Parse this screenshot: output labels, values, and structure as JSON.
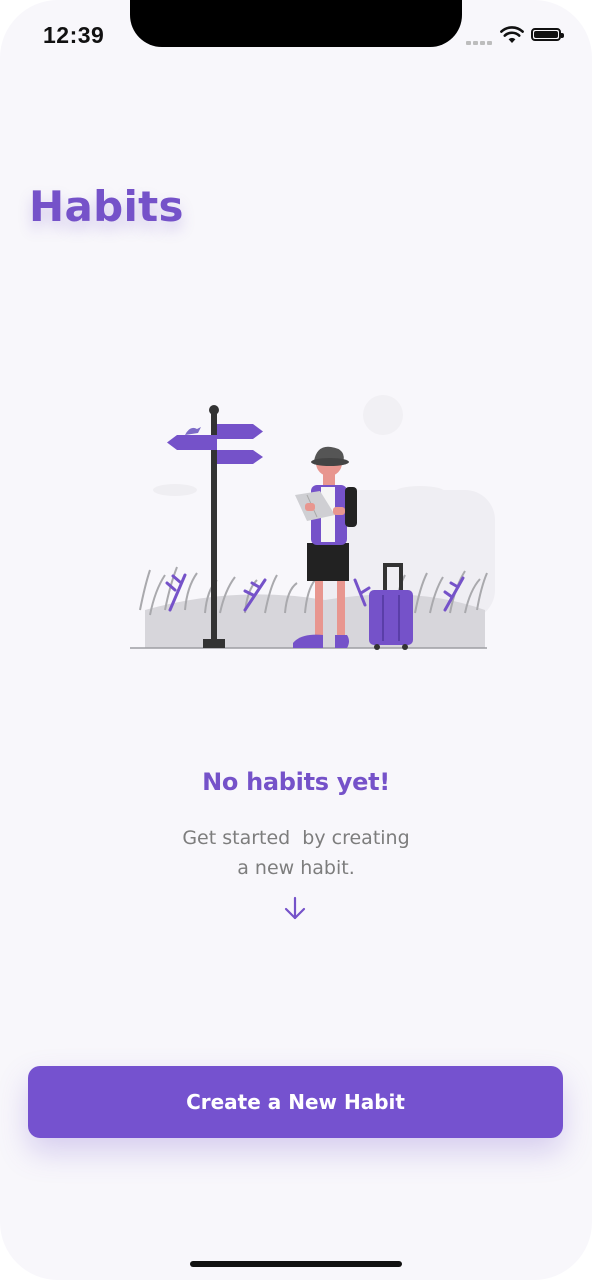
{
  "status_bar": {
    "time": "12:39"
  },
  "header": {
    "title": "Habits"
  },
  "empty_state": {
    "title": "No habits yet!",
    "line1": "Get started  by creating",
    "line2": "a new habit.",
    "arrow_icon": "arrow-down-icon"
  },
  "cta": {
    "label": "Create a New Habit"
  },
  "colors": {
    "accent": "#7552c9",
    "background": "#f8f7fb",
    "secondary_text": "#7d7d7d"
  }
}
